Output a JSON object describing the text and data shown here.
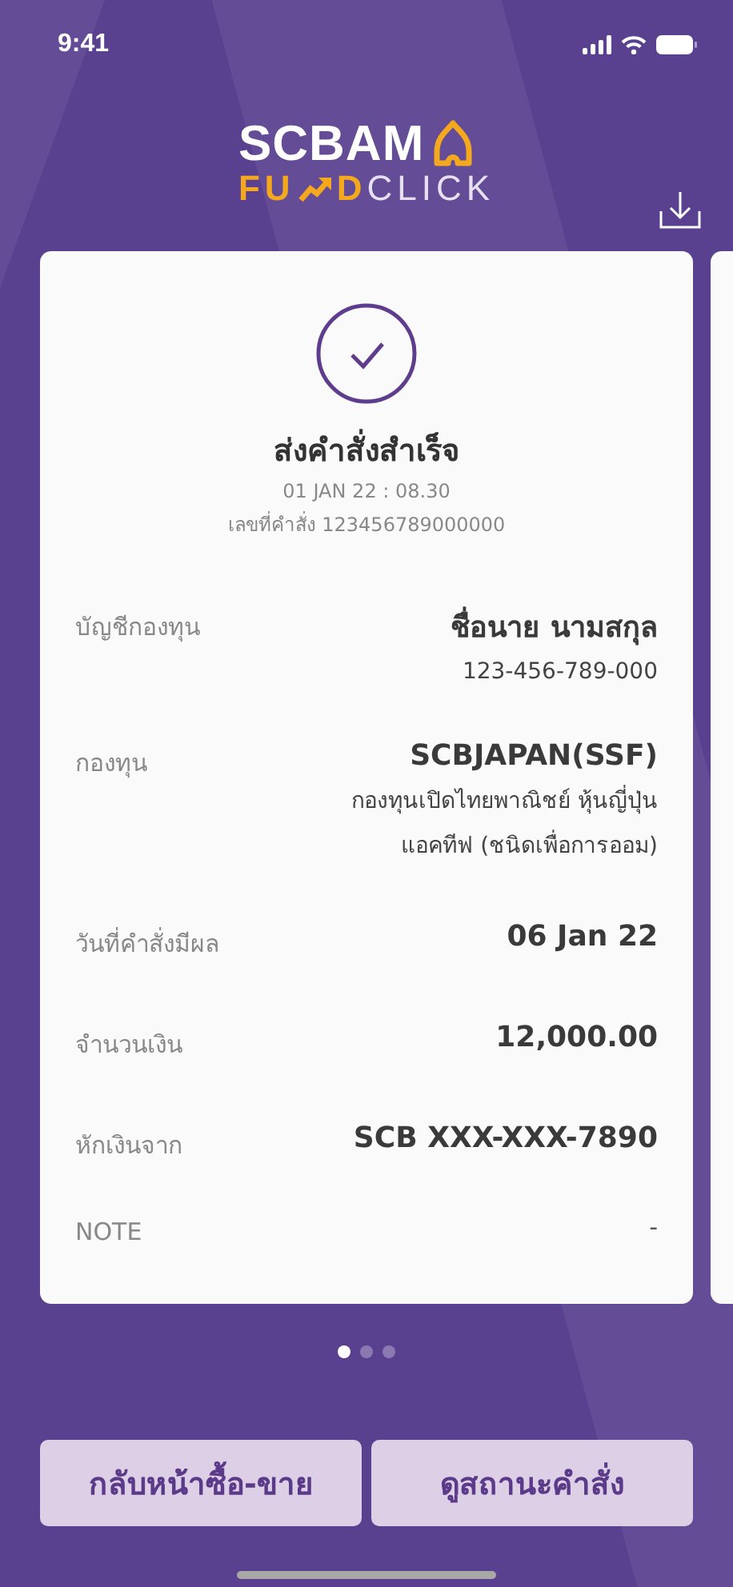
{
  "status_bar": {
    "time": "9:41"
  },
  "logo": {
    "top": "SCBAM",
    "fund_start": "FU",
    "fund_end": "D",
    "click": "CLICK"
  },
  "receipt": {
    "title": "ส่งคำสั่งสำเร็จ",
    "datetime": "01 JAN 22 : 08.30",
    "order_number": "เลขที่คำสั่ง 123456789000000",
    "rows": [
      {
        "label": "บัญชีกองทุน",
        "value": "ชื่อนาย นามสกุล",
        "details": [
          "123-456-789-000"
        ],
        "emphasis": true
      },
      {
        "label": "กองทุน",
        "value": "SCBJAPAN(SSF)",
        "details": [
          "กองทุนเปิดไทยพาณิชย์ หุ้นญี่ปุ่น",
          "แอคทีฟ (ชนิดเพื่อการออม)"
        ],
        "emphasis": true
      },
      {
        "label": "วันที่คำสั่งมีผล",
        "value": "06 Jan 22",
        "emphasis": true
      },
      {
        "label": "จำนวนเงิน",
        "value": "12,000.00",
        "emphasis": true
      },
      {
        "label": "หักเงินจาก",
        "value": "SCB XXX-XXX-7890",
        "emphasis": true
      },
      {
        "label": "NOTE",
        "value": "-",
        "emphasis": false
      }
    ]
  },
  "page_dots": [
    {
      "selected": true
    },
    {
      "selected": false
    },
    {
      "selected": false
    }
  ],
  "buttons": [
    {
      "label": "กลับหน้าซื้อ-ขาย"
    },
    {
      "label": "ดูสถานะคำสั่ง"
    }
  ]
}
